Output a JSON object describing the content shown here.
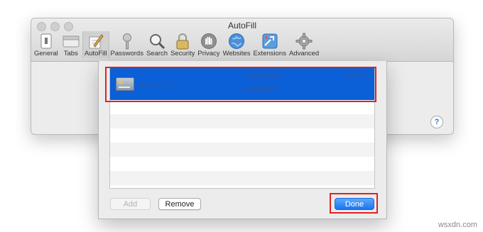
{
  "window": {
    "title": "AutoFill",
    "toolbar": [
      {
        "label": "General",
        "icon": "general-icon"
      },
      {
        "label": "Tabs",
        "icon": "tabs-icon"
      },
      {
        "label": "AutoFill",
        "icon": "autofill-icon",
        "active": true
      },
      {
        "label": "Passwords",
        "icon": "key-icon"
      },
      {
        "label": "Search",
        "icon": "magnifier-icon"
      },
      {
        "label": "Security",
        "icon": "lock-icon"
      },
      {
        "label": "Privacy",
        "icon": "hand-icon"
      },
      {
        "label": "Websites",
        "icon": "globe-icon"
      },
      {
        "label": "Extensions",
        "icon": "puzzle-icon"
      },
      {
        "label": "Advanced",
        "icon": "gear-icon"
      }
    ],
    "help_label": "?"
  },
  "sheet": {
    "card": {
      "description": "Description",
      "card_number": "Card number",
      "cardholder": "Cardholder",
      "expiry": "MM/YY"
    },
    "buttons": {
      "add": "Add",
      "remove": "Remove",
      "done": "Done"
    }
  },
  "watermark": "wsxdn.com",
  "colors": {
    "selection": "#0b5fd7",
    "highlight": "#e0231e",
    "done_button": "#1975f0"
  }
}
